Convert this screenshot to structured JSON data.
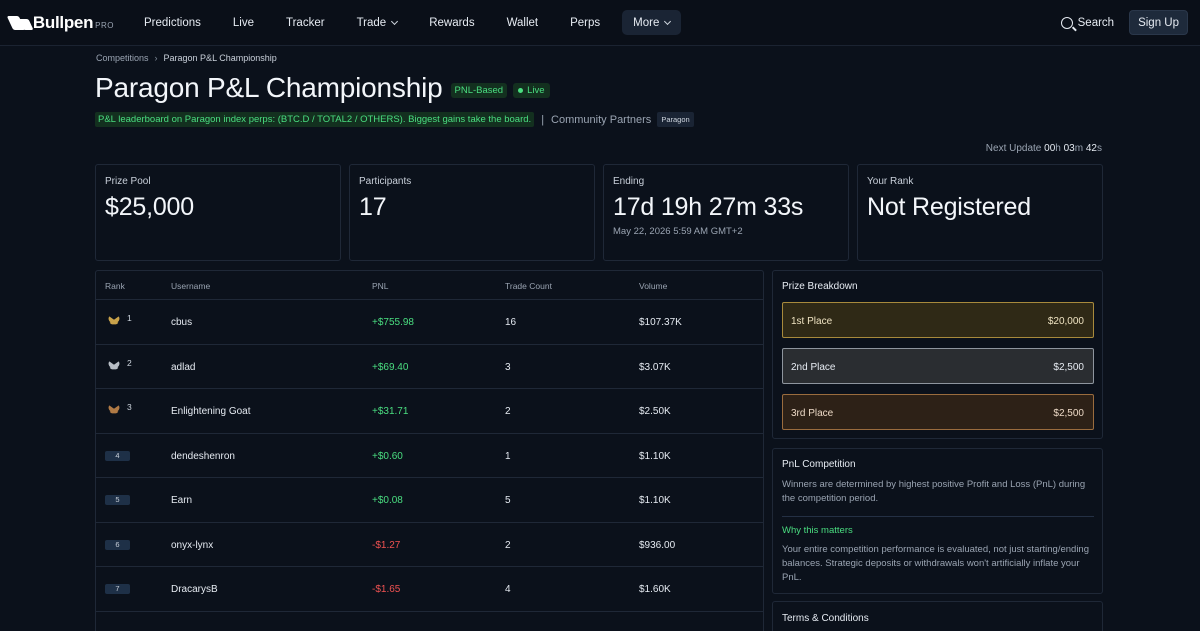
{
  "nav": {
    "logo_text": "Bullpen",
    "logo_suffix": "PRO",
    "items": [
      "Predictions",
      "Live",
      "Tracker",
      "Trade",
      "Rewards",
      "Wallet",
      "Perps",
      "More"
    ],
    "search_label": "Search",
    "signup_label": "Sign Up"
  },
  "breadcrumb": {
    "root": "Competitions",
    "current": "Paragon P&L Championship"
  },
  "header": {
    "title": "Paragon P&L Championship",
    "badge_type": "PNL-Based",
    "badge_status": "Live",
    "description": "P&L leaderboard on Paragon index perps: (BTC.D / TOTAL2 / OTHERS). Biggest gains take the board.",
    "separator": "|",
    "partners_label": "Community Partners",
    "partner_tag": "Paragon"
  },
  "next_update": {
    "label": "Next Update",
    "h": "00",
    "h_unit": "h",
    "m": "03",
    "m_unit": "m",
    "s": "42",
    "s_unit": "s"
  },
  "stats": {
    "prize_pool": {
      "label": "Prize Pool",
      "value": "$25,000"
    },
    "participants": {
      "label": "Participants",
      "value": "17"
    },
    "ending": {
      "label": "Ending",
      "value": "17d 19h 27m 33s",
      "sub": "May 22, 2026 5:59 AM GMT+2"
    },
    "your_rank": {
      "label": "Your Rank",
      "value": "Not Registered"
    }
  },
  "table": {
    "headers": [
      "Rank",
      "Username",
      "PNL",
      "Trade Count",
      "Volume"
    ],
    "rows": [
      {
        "rank": "1",
        "username": "cbus",
        "pnl": "+$755.98",
        "trades": "16",
        "volume": "$107.37K"
      },
      {
        "rank": "2",
        "username": "adlad",
        "pnl": "+$69.40",
        "trades": "3",
        "volume": "$3.07K"
      },
      {
        "rank": "3",
        "username": "Enlightening Goat",
        "pnl": "+$31.71",
        "trades": "2",
        "volume": "$2.50K"
      },
      {
        "rank": "4",
        "username": "dendeshenron",
        "pnl": "+$0.60",
        "trades": "1",
        "volume": "$1.10K"
      },
      {
        "rank": "5",
        "username": "Earn",
        "pnl": "+$0.08",
        "trades": "5",
        "volume": "$1.10K"
      },
      {
        "rank": "6",
        "username": "onyx-lynx",
        "pnl": "-$1.27",
        "trades": "2",
        "volume": "$936.00"
      },
      {
        "rank": "7",
        "username": "DracarysB",
        "pnl": "-$1.65",
        "trades": "4",
        "volume": "$1.60K"
      }
    ]
  },
  "colors": {
    "gold": "#c9a24a",
    "silver": "#b8bec6",
    "bronze": "#b07a45",
    "positive": "#4ade80",
    "negative": "#f05252"
  },
  "prize_breakdown": {
    "title": "Prize Breakdown",
    "items": [
      {
        "place": "1st Place",
        "amount": "$20,000"
      },
      {
        "place": "2nd Place",
        "amount": "$2,500"
      },
      {
        "place": "3rd Place",
        "amount": "$2,500"
      }
    ]
  },
  "pnl_competition": {
    "title": "PnL Competition",
    "text": "Winners are determined by highest positive Profit and Loss (PnL) during the competition period.",
    "why_title": "Why this matters",
    "why_text": "Your entire competition performance is evaluated, not just starting/ending balances. Strategic deposits or withdrawals won't artificially inflate your PnL."
  },
  "terms": {
    "title": "Terms & Conditions"
  }
}
